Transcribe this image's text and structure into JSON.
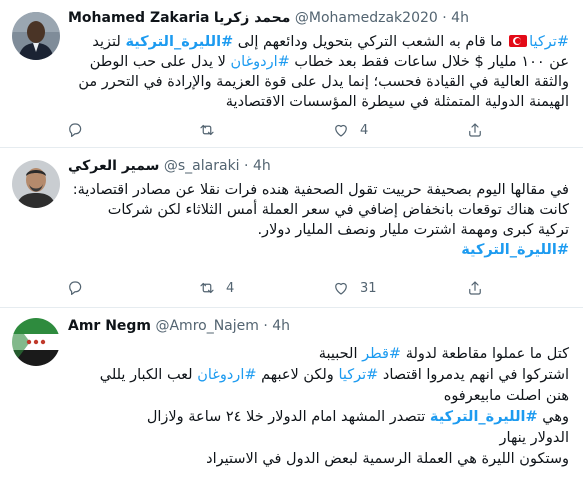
{
  "tweets": [
    {
      "name": "Mohamed Zakaria",
      "name_ar": "محمد زكريا",
      "handle": "@Mohamedzak2020",
      "sep": "·",
      "time": "4h",
      "lines": [
        {
          "hashtag": "#تركيا",
          "text": " ما قام به الشعب التركي بتحويل ودائعهم إلى ",
          "hashtag2": "#الليرة_التركية",
          "text2": " لتزيد"
        },
        {
          "text": "عن ١٠٠ مليار $ خلال ساعات فقط بعد خطاب ",
          "hashtag": "#اردوغان",
          "text2": " لا يدل على حب الوطن"
        },
        {
          "text": "والثقة العالية في القيادة  فحسب؛ إنما يدل على قوة العزيمة والإرادة في التحرر من"
        },
        {
          "text": "الهيمنة الدولية المتمثلة في سيطرة المؤسسات الاقتصادية"
        }
      ],
      "replies": "",
      "retweets": "",
      "likes": "4"
    },
    {
      "name": "سمير العركي",
      "handle": "@s_alaraki",
      "sep": "·",
      "time": "4h",
      "lines": [
        "في مقالها اليوم بصحيفة حرييت تقول الصحفية هنده فرات نقلا عن مصادر اقتصادية:",
        "كانت هناك توقعات بانخفاض إضافي في سعر العملة أمس الثلاثاء لكن شركات",
        "تركية كبرى ومهمة اشترت مليار ونصف المليار دولار."
      ],
      "hashtag": "#الليرة_التركية",
      "replies": "",
      "retweets": "4",
      "likes": "31"
    },
    {
      "name": "Amr Negm",
      "handle": "@Amro_Najem",
      "sep": "·",
      "time": "4h",
      "lines": [
        {
          "text": "كتل ما عملوا مقاطعة لدولة ",
          "hashtag": "#قطر",
          "text2": " الحبيبة"
        },
        {
          "text": "اشتركوا في انهم يدمروا اقتصاد ",
          "hashtag": "#تركيا",
          "text2": " ولكن لاعبهم ",
          "hashtag2": "#اردوغان",
          "text3": "  لعب الكبار يللي"
        },
        {
          "text": "هنن اصلت مابيعرفوه"
        },
        {
          "text": "وهي ",
          "hashtag": "#الليرة_التركية",
          "text2": "  تتصدر المشهد امام الدولار خلا ٢٤ ساعة ولازال"
        },
        {
          "text": "الدولار ينهار"
        },
        {
          "text": "وستكون الليرة هي العملة الرسمية لبعض الدول في الاستيراد"
        }
      ]
    }
  ],
  "colors": {
    "link": "#1d9bf0",
    "muted": "#536471",
    "divider": "#e6ecf0"
  },
  "icons": [
    "reply-icon",
    "retweet-icon",
    "like-icon",
    "share-icon",
    "turkey-flag-icon"
  ]
}
